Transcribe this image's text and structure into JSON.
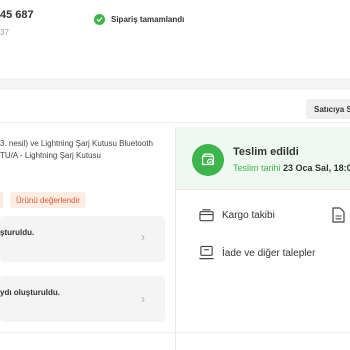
{
  "order": {
    "number_partial": "45 687",
    "sub_partial": "37",
    "status": "Sipariş tamamlandı"
  },
  "seller_button": "Satıcıya S",
  "product": {
    "line1": "3. nesil) ve Lightning Şarj Kutusu Bluetooth",
    "line2": "TU/A - Lightning Şarj Kutusu"
  },
  "review_button": "Ürünü değerlendir",
  "messages": [
    {
      "text": "şturuldu."
    },
    {
      "text": "ydı oluşturuldu."
    }
  ],
  "delivery": {
    "title": "Teslim edildi",
    "date_label": "Teslim tarihi",
    "date_value": "23 Oca Sal, 18:0"
  },
  "actions": {
    "cargo": "Kargo takibi",
    "returns": "İade ve diğer talepler"
  },
  "colors": {
    "accent_green": "#3cb54a",
    "review_orange": "#e8572b"
  }
}
